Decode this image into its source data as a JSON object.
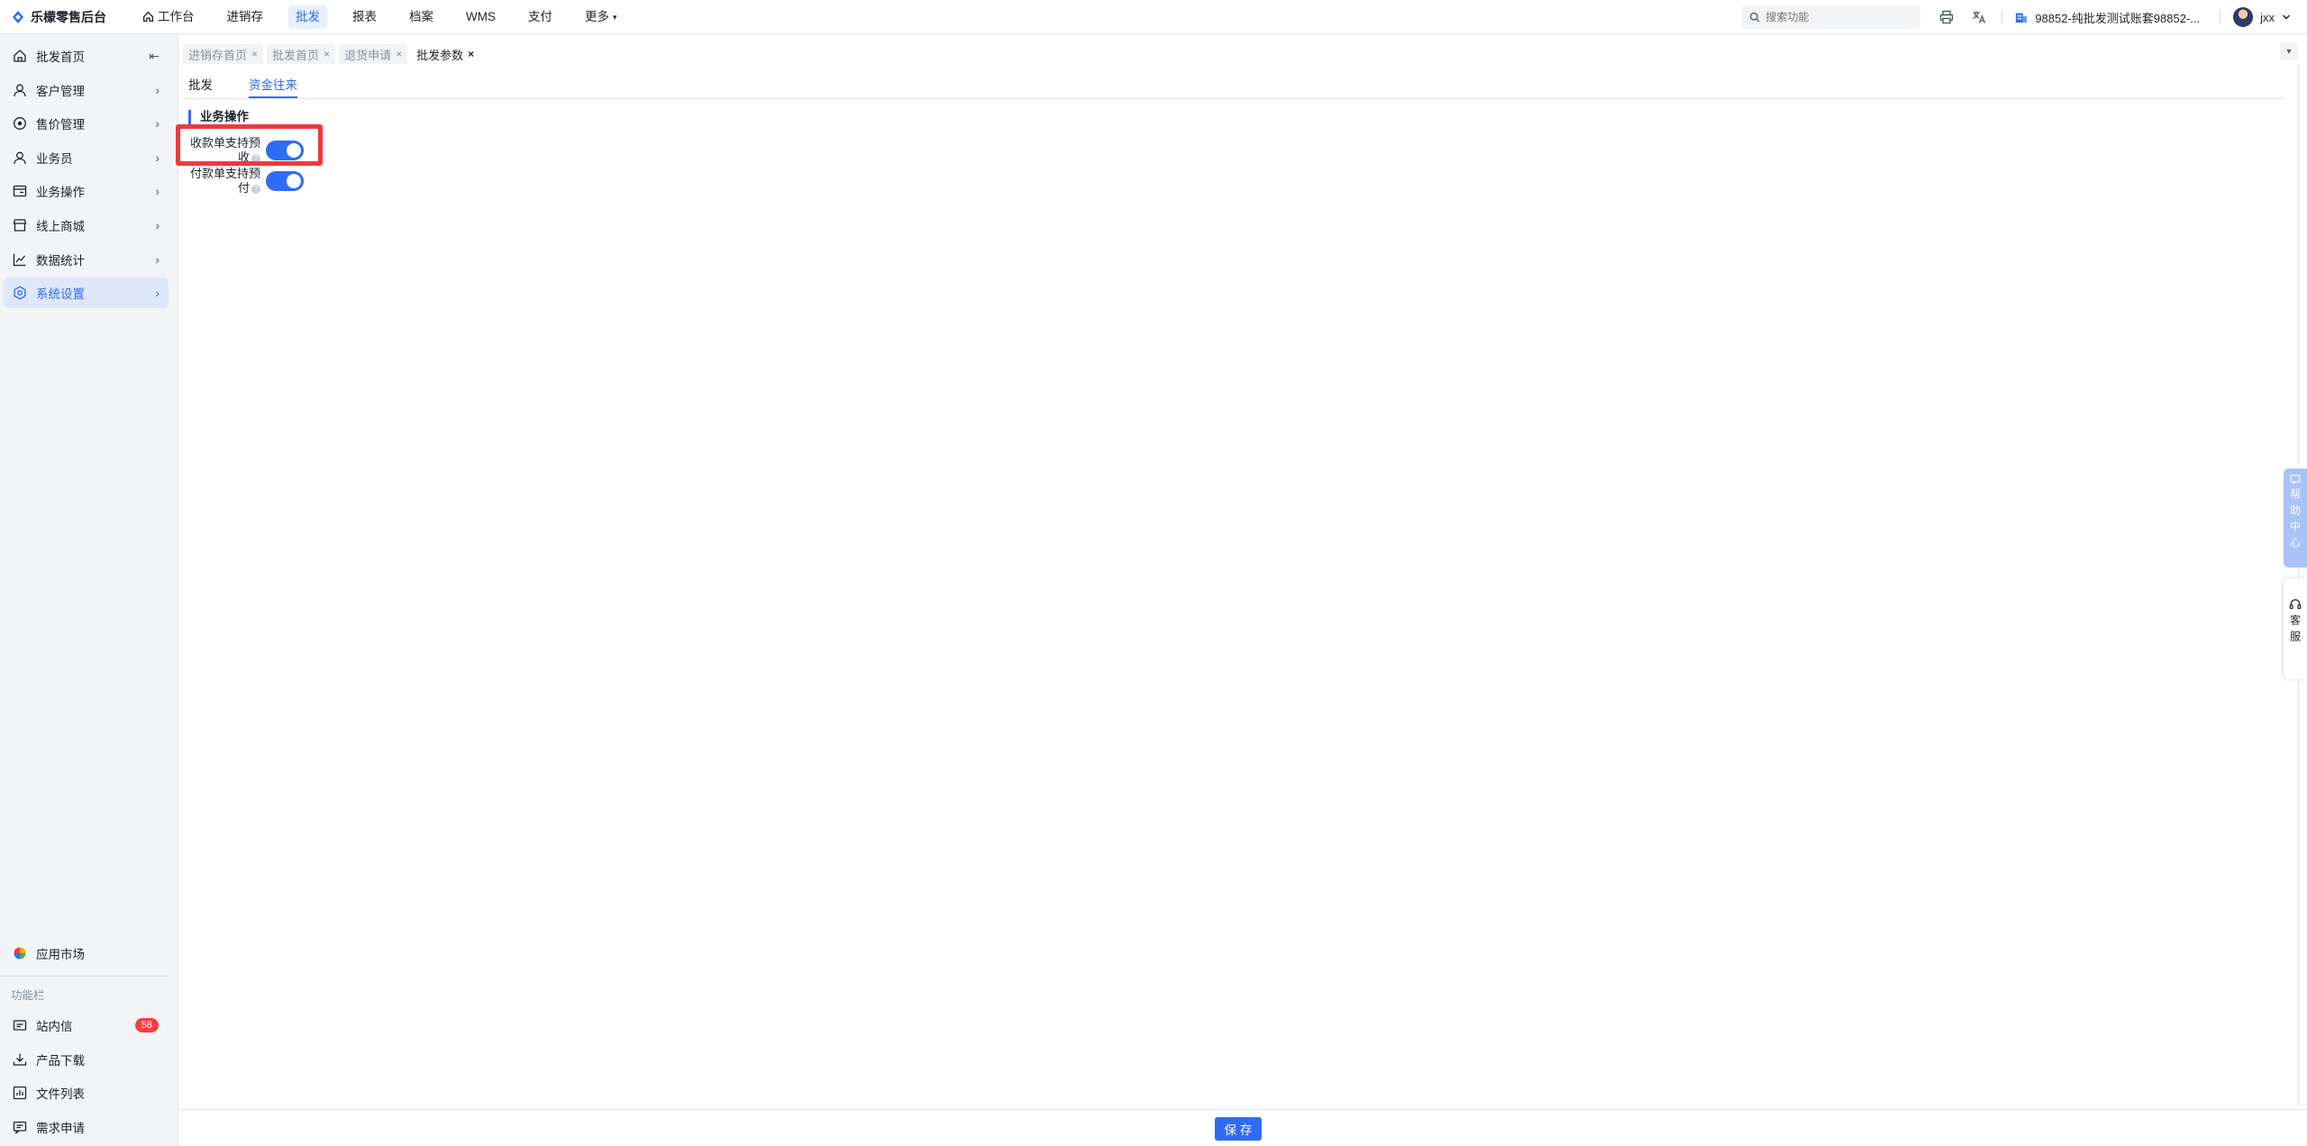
{
  "app": {
    "title": "乐檬零售后台"
  },
  "topnav": [
    {
      "label": "工作台",
      "icon": "home-icon",
      "active": false
    },
    {
      "label": "进销存",
      "active": false
    },
    {
      "label": "批发",
      "active": true
    },
    {
      "label": "报表",
      "active": false
    },
    {
      "label": "档案",
      "active": false
    },
    {
      "label": "WMS",
      "active": false
    },
    {
      "label": "支付",
      "active": false
    },
    {
      "label": "更多",
      "active": false,
      "dropdown": true
    }
  ],
  "search": {
    "placeholder": "搜索功能"
  },
  "company": {
    "name": "98852-纯批发测试账套98852-..."
  },
  "user": {
    "name": "jxx"
  },
  "sidebar": {
    "items": [
      {
        "label": "批发首页",
        "icon": "home-icon"
      },
      {
        "label": "客户管理",
        "icon": "user-icon"
      },
      {
        "label": "售价管理",
        "icon": "price-icon"
      },
      {
        "label": "业务员",
        "icon": "person-icon"
      },
      {
        "label": "业务操作",
        "icon": "operation-icon"
      },
      {
        "label": "线上商城",
        "icon": "store-icon"
      },
      {
        "label": "数据统计",
        "icon": "chart-icon"
      },
      {
        "label": "系统设置",
        "icon": "gear-icon",
        "active": true
      }
    ],
    "app_market": "应用市场",
    "func_label": "功能栏",
    "func_items": [
      {
        "label": "站内信",
        "badge": "58"
      },
      {
        "label": "产品下载"
      },
      {
        "label": "文件列表"
      },
      {
        "label": "需求申请"
      }
    ]
  },
  "tabs": [
    {
      "label": "进销存首页",
      "active": false
    },
    {
      "label": "批发首页",
      "active": false
    },
    {
      "label": "退货申请",
      "active": false
    },
    {
      "label": "批发参数",
      "active": true
    }
  ],
  "subtabs": [
    {
      "label": "批发",
      "active": false
    },
    {
      "label": "资金往来",
      "active": true
    }
  ],
  "section": {
    "title": "业务操作"
  },
  "settings": [
    {
      "label_line1": "收款单支持预",
      "label_line2": "收",
      "enabled": true
    },
    {
      "label_line1": "付款单支持预",
      "label_line2": "付",
      "enabled": true
    }
  ],
  "footer": {
    "save_label": "保 存"
  },
  "float": {
    "help": "帮助中心",
    "service": "客服"
  },
  "colors": {
    "accent": "#2e6cf6",
    "highlight": "#f0393f",
    "badge": "#f53f3f"
  }
}
